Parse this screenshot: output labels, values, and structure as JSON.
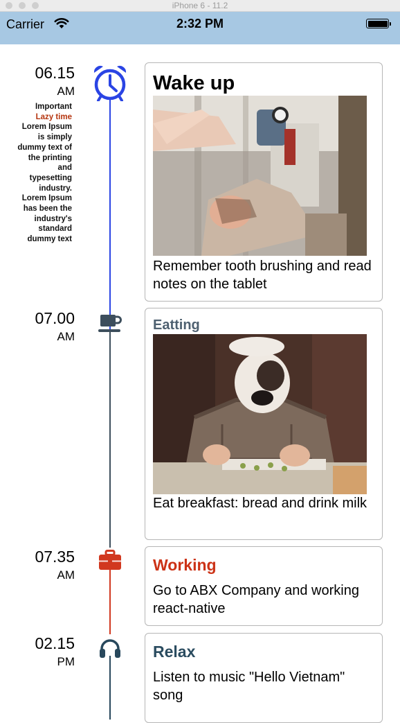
{
  "simulator": {
    "title": "iPhone 6 - 11.2"
  },
  "status_bar": {
    "carrier": "Carrier",
    "time": "2:32 PM"
  },
  "timeline": [
    {
      "time": "06.15",
      "period": "AM",
      "icon": "alarm-clock-icon",
      "color": "#2a44e4",
      "title": "Wake up",
      "title_color": "#000000",
      "image": "Person reclining in a chair with a clock on a wall behind",
      "description": "Remember tooth brushing and read notes on the tablet",
      "side_note": {
        "line1": "Important",
        "line2": "Lazy time",
        "line3": "Lorem Ipsum is simply dummy text of the printing and typesetting industry. Lorem Ipsum has been the industry's standard dummy text"
      }
    },
    {
      "time": "07.00",
      "period": "AM",
      "icon": "coffee-cup-icon",
      "color": "#3d4e5c",
      "title": "Eatting",
      "title_color": "#4e6070",
      "image": "Dog in a plaid jacket and cap eating at a table",
      "description": "Eat breakfast: bread and drink milk"
    },
    {
      "time": "07.35",
      "period": "AM",
      "icon": "briefcase-icon",
      "color": "#d1381f",
      "title": "Working",
      "title_color": "#cc3216",
      "description": "Go to ABX Company and working react-native"
    },
    {
      "time": "02.15",
      "period": "PM",
      "icon": "headphones-icon",
      "color": "#28485c",
      "title": "Relax",
      "title_color": "#2b4c60",
      "description": "Listen to music \"Hello Vietnam\" song"
    }
  ]
}
